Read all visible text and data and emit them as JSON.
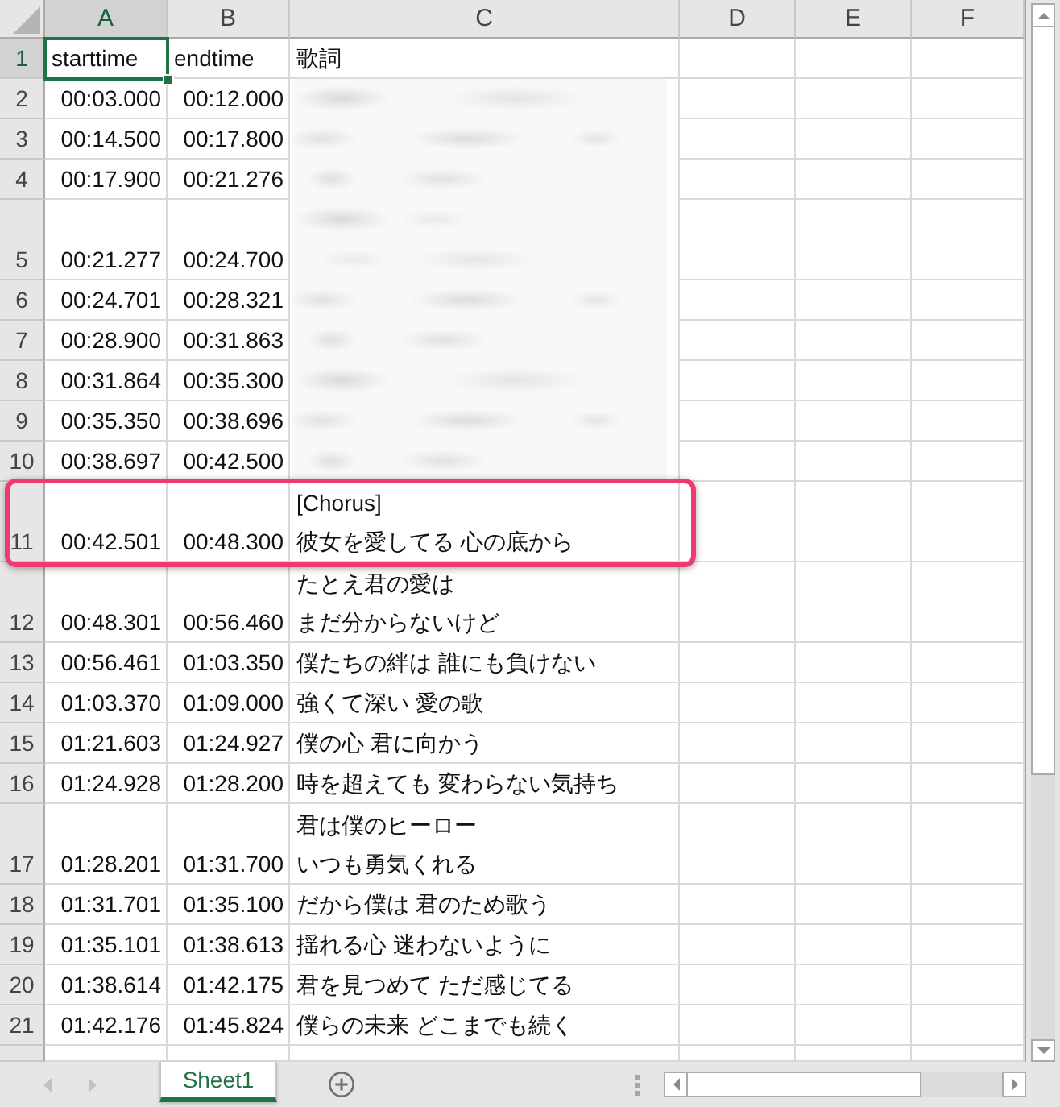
{
  "sheet": {
    "columns": [
      {
        "letter": "A",
        "selected": true
      },
      {
        "letter": "B",
        "selected": false
      },
      {
        "letter": "C",
        "selected": false
      },
      {
        "letter": "D",
        "selected": false
      },
      {
        "letter": "E",
        "selected": false
      },
      {
        "letter": "F",
        "selected": false
      }
    ],
    "rows": [
      {
        "number": "1",
        "kind": "header",
        "selected": true,
        "tall": false,
        "blurred": false,
        "highlighted": false,
        "cells": [
          "starttime",
          "endtime"
        ],
        "lyric": [
          "歌詞"
        ]
      },
      {
        "number": "2",
        "kind": "entry",
        "selected": false,
        "tall": false,
        "blurred": true,
        "highlighted": false,
        "cells": [
          "00:03.000",
          "00:12.000"
        ]
      },
      {
        "number": "3",
        "kind": "entry",
        "selected": false,
        "tall": false,
        "blurred": true,
        "highlighted": false,
        "cells": [
          "00:14.500",
          "00:17.800"
        ]
      },
      {
        "number": "4",
        "kind": "entry",
        "selected": false,
        "tall": false,
        "blurred": true,
        "highlighted": false,
        "cells": [
          "00:17.900",
          "00:21.276"
        ]
      },
      {
        "number": "5",
        "kind": "entry",
        "selected": false,
        "tall": true,
        "blurred": true,
        "highlighted": false,
        "cells": [
          "00:21.277",
          "00:24.700"
        ]
      },
      {
        "number": "6",
        "kind": "entry",
        "selected": false,
        "tall": false,
        "blurred": true,
        "highlighted": false,
        "cells": [
          "00:24.701",
          "00:28.321"
        ]
      },
      {
        "number": "7",
        "kind": "entry",
        "selected": false,
        "tall": false,
        "blurred": true,
        "highlighted": false,
        "cells": [
          "00:28.900",
          "00:31.863"
        ]
      },
      {
        "number": "8",
        "kind": "entry",
        "selected": false,
        "tall": false,
        "blurred": true,
        "highlighted": false,
        "cells": [
          "00:31.864",
          "00:35.300"
        ]
      },
      {
        "number": "9",
        "kind": "entry",
        "selected": false,
        "tall": false,
        "blurred": true,
        "highlighted": false,
        "cells": [
          "00:35.350",
          "00:38.696"
        ]
      },
      {
        "number": "10",
        "kind": "entry",
        "selected": false,
        "tall": false,
        "blurred": true,
        "highlighted": false,
        "cells": [
          "00:38.697",
          "00:42.500"
        ]
      },
      {
        "number": "11",
        "kind": "entry",
        "selected": false,
        "tall": true,
        "blurred": false,
        "highlighted": true,
        "cells": [
          "00:42.501",
          "00:48.300"
        ],
        "lyric": [
          "[Chorus]",
          "彼女を愛してる 心の底から"
        ]
      },
      {
        "number": "12",
        "kind": "entry",
        "selected": false,
        "tall": true,
        "blurred": false,
        "highlighted": false,
        "cells": [
          "00:48.301",
          "00:56.460"
        ],
        "lyric": [
          "たとえ君の愛は",
          "まだ分からないけど"
        ]
      },
      {
        "number": "13",
        "kind": "entry",
        "selected": false,
        "tall": false,
        "blurred": false,
        "highlighted": false,
        "cells": [
          "00:56.461",
          "01:03.350"
        ],
        "lyric": [
          "僕たちの絆は 誰にも負けない"
        ]
      },
      {
        "number": "14",
        "kind": "entry",
        "selected": false,
        "tall": false,
        "blurred": false,
        "highlighted": false,
        "cells": [
          "01:03.370",
          "01:09.000"
        ],
        "lyric": [
          "強くて深い 愛の歌"
        ]
      },
      {
        "number": "15",
        "kind": "entry",
        "selected": false,
        "tall": false,
        "blurred": false,
        "highlighted": false,
        "cells": [
          "01:21.603",
          "01:24.927"
        ],
        "lyric": [
          "僕の心 君に向かう"
        ]
      },
      {
        "number": "16",
        "kind": "entry",
        "selected": false,
        "tall": false,
        "blurred": false,
        "highlighted": false,
        "cells": [
          "01:24.928",
          "01:28.200"
        ],
        "lyric": [
          "時を超えても 変わらない気持ち"
        ]
      },
      {
        "number": "17",
        "kind": "entry",
        "selected": false,
        "tall": true,
        "blurred": false,
        "highlighted": false,
        "cells": [
          "01:28.201",
          "01:31.700"
        ],
        "lyric": [
          "君は僕のヒーロー",
          "いつも勇気くれる"
        ]
      },
      {
        "number": "18",
        "kind": "entry",
        "selected": false,
        "tall": false,
        "blurred": false,
        "highlighted": false,
        "cells": [
          "01:31.701",
          "01:35.100"
        ],
        "lyric": [
          "だから僕は 君のため歌う"
        ]
      },
      {
        "number": "19",
        "kind": "entry",
        "selected": false,
        "tall": false,
        "blurred": false,
        "highlighted": false,
        "cells": [
          "01:35.101",
          "01:38.613"
        ],
        "lyric": [
          "揺れる心 迷わないように"
        ]
      },
      {
        "number": "20",
        "kind": "entry",
        "selected": false,
        "tall": false,
        "blurred": false,
        "highlighted": false,
        "cells": [
          "01:38.614",
          "01:42.175"
        ],
        "lyric": [
          "君を見つめて ただ感じてる"
        ]
      },
      {
        "number": "21",
        "kind": "entry",
        "selected": false,
        "tall": false,
        "blurred": false,
        "highlighted": false,
        "cells": [
          "01:42.176",
          "01:45.824"
        ],
        "lyric": [
          "僕らの未来 どこまでも続く"
        ]
      }
    ]
  },
  "sheet_tabs": [
    {
      "label": "Sheet1",
      "selected": true
    }
  ]
}
